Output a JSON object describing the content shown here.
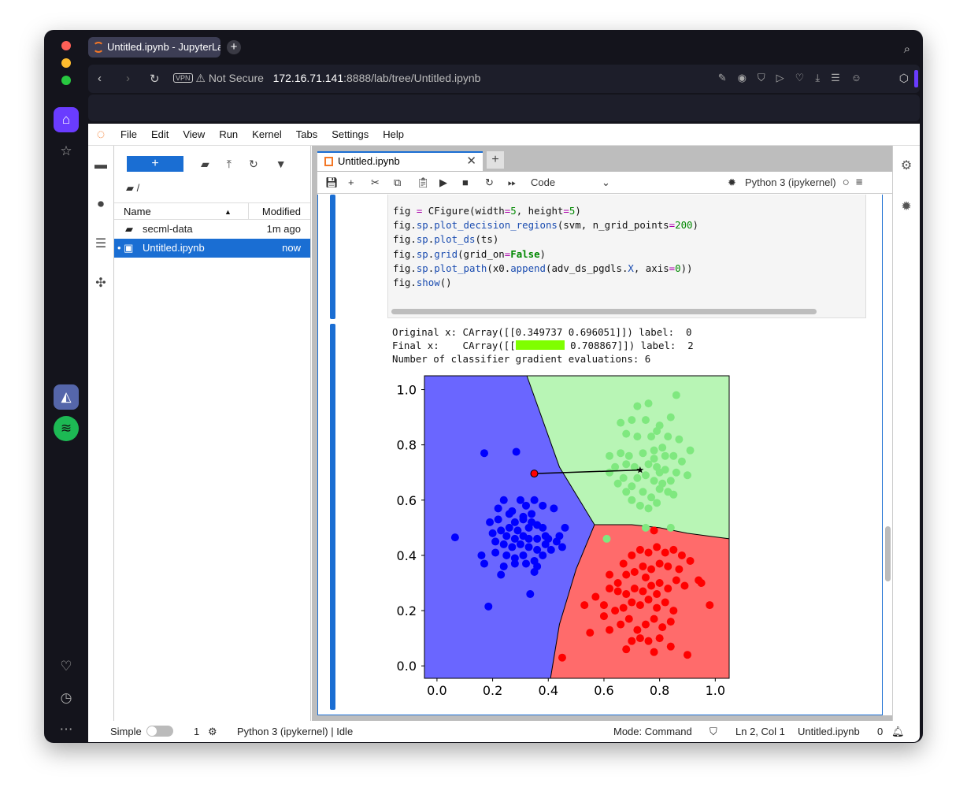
{
  "browser": {
    "tab_title": "Untitled.ipynb - JupyterLab",
    "vpn": "VPN",
    "not_secure": "Not Secure",
    "url_host": "172.16.71.141",
    "url_rest": ":8888/lab/tree/Untitled.ipynb"
  },
  "menu": [
    "File",
    "Edit",
    "View",
    "Run",
    "Kernel",
    "Tabs",
    "Settings",
    "Help"
  ],
  "filebrowser": {
    "new_label": "+",
    "path": "/",
    "col_name": "Name",
    "col_modified": "Modified",
    "files": [
      {
        "name": "secml-data",
        "modified": "1m ago",
        "type": "folder"
      },
      {
        "name": "Untitled.ipynb",
        "modified": "now",
        "type": "notebook"
      }
    ]
  },
  "notebook": {
    "tab": "Untitled.ipynb",
    "cell_type": "Code",
    "kernel": "Python 3 (ipykernel)",
    "output": [
      "Original x: CArray([[0.349737 0.696051]]) label:  0",
      "Number of classifier gradient evaluations: 6"
    ],
    "final_prefix": "Final x:    CArray([[",
    "final_suffix": " 0.708867]]) label:  2"
  },
  "status": {
    "mode_label": "Simple",
    "terminals": "1",
    "kernel_status": "Python 3 (ipykernel) | Idle",
    "mode": "Mode: Command",
    "position": "Ln 2, Col 1",
    "file": "Untitled.ipynb",
    "notifications": "0"
  },
  "chart_data": {
    "type": "scatter",
    "xlim": [
      -0.045,
      1.05
    ],
    "ylim": [
      -0.045,
      1.05
    ],
    "xticks": [
      "0.0",
      "0.2",
      "0.4",
      "0.6",
      "0.8",
      "1.0"
    ],
    "yticks": [
      "0.0",
      "0.2",
      "0.4",
      "0.6",
      "0.8",
      "1.0"
    ],
    "grid": false,
    "colors": {
      "region0": "#6a66ff",
      "region1": "#b8f5b5",
      "region2": "#ff6b6b",
      "class0": "#0000ff",
      "class1": "#7fe87f",
      "class2": "#ff0000"
    },
    "boundary_01": [
      [
        0.323,
        1.05
      ],
      [
        0.44,
        0.72
      ],
      [
        0.566,
        0.511
      ],
      [
        0.5,
        0.35
      ],
      [
        0.44,
        0.15
      ],
      [
        0.408,
        -0.045
      ]
    ],
    "boundary_12": [
      [
        0.566,
        0.511
      ],
      [
        0.7,
        0.511
      ],
      [
        0.8,
        0.5
      ],
      [
        0.9,
        0.48
      ],
      [
        1.05,
        0.46
      ]
    ],
    "path": [
      [
        0.3497,
        0.6961
      ],
      [
        0.73,
        0.7089
      ]
    ],
    "series": [
      {
        "name": "class 0",
        "points": [
          [
            0.17,
            0.77
          ],
          [
            0.285,
            0.775
          ],
          [
            0.065,
            0.465
          ],
          [
            0.185,
            0.215
          ],
          [
            0.335,
            0.26
          ],
          [
            0.22,
            0.57
          ],
          [
            0.24,
            0.6
          ],
          [
            0.26,
            0.55
          ],
          [
            0.3,
            0.6
          ],
          [
            0.32,
            0.58
          ],
          [
            0.35,
            0.6
          ],
          [
            0.38,
            0.58
          ],
          [
            0.42,
            0.57
          ],
          [
            0.28,
            0.52
          ],
          [
            0.31,
            0.53
          ],
          [
            0.34,
            0.52
          ],
          [
            0.36,
            0.51
          ],
          [
            0.38,
            0.5
          ],
          [
            0.33,
            0.5
          ],
          [
            0.29,
            0.49
          ],
          [
            0.26,
            0.5
          ],
          [
            0.23,
            0.49
          ],
          [
            0.2,
            0.48
          ],
          [
            0.25,
            0.47
          ],
          [
            0.28,
            0.46
          ],
          [
            0.31,
            0.47
          ],
          [
            0.33,
            0.46
          ],
          [
            0.36,
            0.46
          ],
          [
            0.4,
            0.46
          ],
          [
            0.44,
            0.47
          ],
          [
            0.46,
            0.5
          ],
          [
            0.43,
            0.45
          ],
          [
            0.39,
            0.44
          ],
          [
            0.36,
            0.42
          ],
          [
            0.33,
            0.43
          ],
          [
            0.3,
            0.44
          ],
          [
            0.27,
            0.43
          ],
          [
            0.24,
            0.44
          ],
          [
            0.21,
            0.45
          ],
          [
            0.21,
            0.41
          ],
          [
            0.25,
            0.4
          ],
          [
            0.28,
            0.39
          ],
          [
            0.31,
            0.4
          ],
          [
            0.35,
            0.38
          ],
          [
            0.38,
            0.4
          ],
          [
            0.16,
            0.4
          ],
          [
            0.17,
            0.37
          ],
          [
            0.24,
            0.36
          ],
          [
            0.28,
            0.37
          ],
          [
            0.32,
            0.37
          ],
          [
            0.36,
            0.36
          ],
          [
            0.23,
            0.33
          ],
          [
            0.41,
            0.42
          ],
          [
            0.45,
            0.43
          ],
          [
            0.27,
            0.56
          ],
          [
            0.31,
            0.54
          ],
          [
            0.19,
            0.52
          ],
          [
            0.22,
            0.53
          ],
          [
            0.35,
            0.34
          ],
          [
            0.39,
            0.47
          ],
          [
            0.34,
            0.55
          ]
        ]
      },
      {
        "name": "class 1",
        "points": [
          [
            0.61,
            0.46
          ],
          [
            0.75,
            0.5
          ],
          [
            0.84,
            0.5
          ],
          [
            0.86,
            0.98
          ],
          [
            0.72,
            0.94
          ],
          [
            0.76,
            0.95
          ],
          [
            0.66,
            0.88
          ],
          [
            0.7,
            0.89
          ],
          [
            0.75,
            0.89
          ],
          [
            0.8,
            0.87
          ],
          [
            0.84,
            0.9
          ],
          [
            0.68,
            0.84
          ],
          [
            0.72,
            0.83
          ],
          [
            0.77,
            0.83
          ],
          [
            0.79,
            0.85
          ],
          [
            0.83,
            0.83
          ],
          [
            0.87,
            0.82
          ],
          [
            0.91,
            0.78
          ],
          [
            0.62,
            0.76
          ],
          [
            0.66,
            0.77
          ],
          [
            0.69,
            0.76
          ],
          [
            0.74,
            0.77
          ],
          [
            0.78,
            0.78
          ],
          [
            0.81,
            0.79
          ],
          [
            0.85,
            0.76
          ],
          [
            0.88,
            0.74
          ],
          [
            0.64,
            0.72
          ],
          [
            0.68,
            0.73
          ],
          [
            0.71,
            0.72
          ],
          [
            0.76,
            0.73
          ],
          [
            0.79,
            0.72
          ],
          [
            0.82,
            0.71
          ],
          [
            0.86,
            0.7
          ],
          [
            0.9,
            0.69
          ],
          [
            0.67,
            0.68
          ],
          [
            0.72,
            0.68
          ],
          [
            0.75,
            0.69
          ],
          [
            0.78,
            0.67
          ],
          [
            0.81,
            0.66
          ],
          [
            0.84,
            0.67
          ],
          [
            0.7,
            0.65
          ],
          [
            0.74,
            0.63
          ],
          [
            0.77,
            0.61
          ],
          [
            0.8,
            0.64
          ],
          [
            0.83,
            0.63
          ],
          [
            0.7,
            0.6
          ],
          [
            0.73,
            0.58
          ],
          [
            0.76,
            0.57
          ],
          [
            0.79,
            0.59
          ],
          [
            0.85,
            0.62
          ],
          [
            0.68,
            0.63
          ],
          [
            0.65,
            0.66
          ],
          [
            0.62,
            0.7
          ],
          [
            0.82,
            0.76
          ],
          [
            0.8,
            0.7
          ],
          [
            0.78,
            0.75
          ]
        ]
      },
      {
        "name": "class 2",
        "points": [
          [
            0.78,
            0.49
          ],
          [
            0.57,
            0.25
          ],
          [
            0.6,
            0.22
          ],
          [
            0.65,
            0.3
          ],
          [
            0.62,
            0.33
          ],
          [
            0.67,
            0.37
          ],
          [
            0.7,
            0.4
          ],
          [
            0.73,
            0.42
          ],
          [
            0.76,
            0.41
          ],
          [
            0.79,
            0.43
          ],
          [
            0.82,
            0.41
          ],
          [
            0.85,
            0.42
          ],
          [
            0.68,
            0.33
          ],
          [
            0.71,
            0.34
          ],
          [
            0.74,
            0.36
          ],
          [
            0.77,
            0.35
          ],
          [
            0.8,
            0.37
          ],
          [
            0.83,
            0.36
          ],
          [
            0.87,
            0.35
          ],
          [
            0.94,
            0.31
          ],
          [
            0.95,
            0.3
          ],
          [
            0.65,
            0.27
          ],
          [
            0.68,
            0.26
          ],
          [
            0.71,
            0.28
          ],
          [
            0.74,
            0.27
          ],
          [
            0.77,
            0.29
          ],
          [
            0.8,
            0.3
          ],
          [
            0.83,
            0.28
          ],
          [
            0.86,
            0.31
          ],
          [
            0.89,
            0.29
          ],
          [
            0.6,
            0.18
          ],
          [
            0.64,
            0.2
          ],
          [
            0.67,
            0.21
          ],
          [
            0.7,
            0.23
          ],
          [
            0.73,
            0.22
          ],
          [
            0.76,
            0.24
          ],
          [
            0.79,
            0.21
          ],
          [
            0.82,
            0.23
          ],
          [
            0.85,
            0.2
          ],
          [
            0.98,
            0.22
          ],
          [
            0.66,
            0.15
          ],
          [
            0.69,
            0.17
          ],
          [
            0.72,
            0.13
          ],
          [
            0.75,
            0.15
          ],
          [
            0.78,
            0.17
          ],
          [
            0.81,
            0.14
          ],
          [
            0.84,
            0.16
          ],
          [
            0.53,
            0.22
          ],
          [
            0.55,
            0.12
          ],
          [
            0.62,
            0.13
          ],
          [
            0.7,
            0.09
          ],
          [
            0.73,
            0.1
          ],
          [
            0.76,
            0.09
          ],
          [
            0.8,
            0.1
          ],
          [
            0.84,
            0.07
          ],
          [
            0.78,
            0.05
          ],
          [
            0.9,
            0.04
          ],
          [
            0.45,
            0.03
          ],
          [
            0.68,
            0.06
          ],
          [
            0.91,
            0.38
          ],
          [
            0.88,
            0.4
          ],
          [
            0.62,
            0.28
          ],
          [
            0.75,
            0.32
          ],
          [
            0.79,
            0.26
          ]
        ]
      }
    ]
  }
}
